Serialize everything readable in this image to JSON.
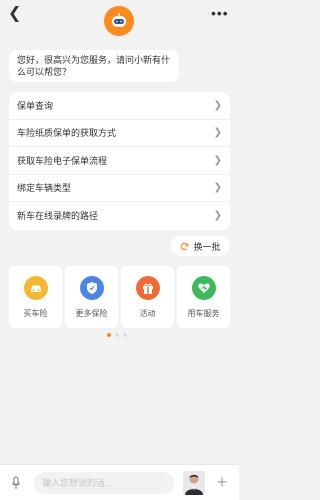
{
  "header": {
    "more": "•••"
  },
  "greeting": {
    "text": "您好，很高兴为您服务，请问小新有什么可以帮您？"
  },
  "questions": [
    {
      "label": "保单查询"
    },
    {
      "label": "车险纸质保单的获取方式"
    },
    {
      "label": "获取车险电子保单流程"
    },
    {
      "label": "绑定车辆类型"
    },
    {
      "label": "新车在线录牌的路径"
    }
  ],
  "refresh": {
    "label": "换一批",
    "icon": "refresh-icon"
  },
  "services": [
    {
      "label": "买车险",
      "icon": "car-icon",
      "color": "#f5b731"
    },
    {
      "label": "更多保险",
      "icon": "shield-icon",
      "color": "#4a86e8"
    },
    {
      "label": "活动",
      "icon": "gift-icon",
      "color": "#f06a35"
    },
    {
      "label": "用车服务",
      "icon": "heart-icon",
      "color": "#3dbb5c"
    }
  ],
  "pager": {
    "pages": 3,
    "current": 1
  },
  "input": {
    "placeholder": "输入您想说的话..."
  },
  "colors": {
    "accent": "#ff8a1c",
    "background": "#f2f2f2"
  }
}
